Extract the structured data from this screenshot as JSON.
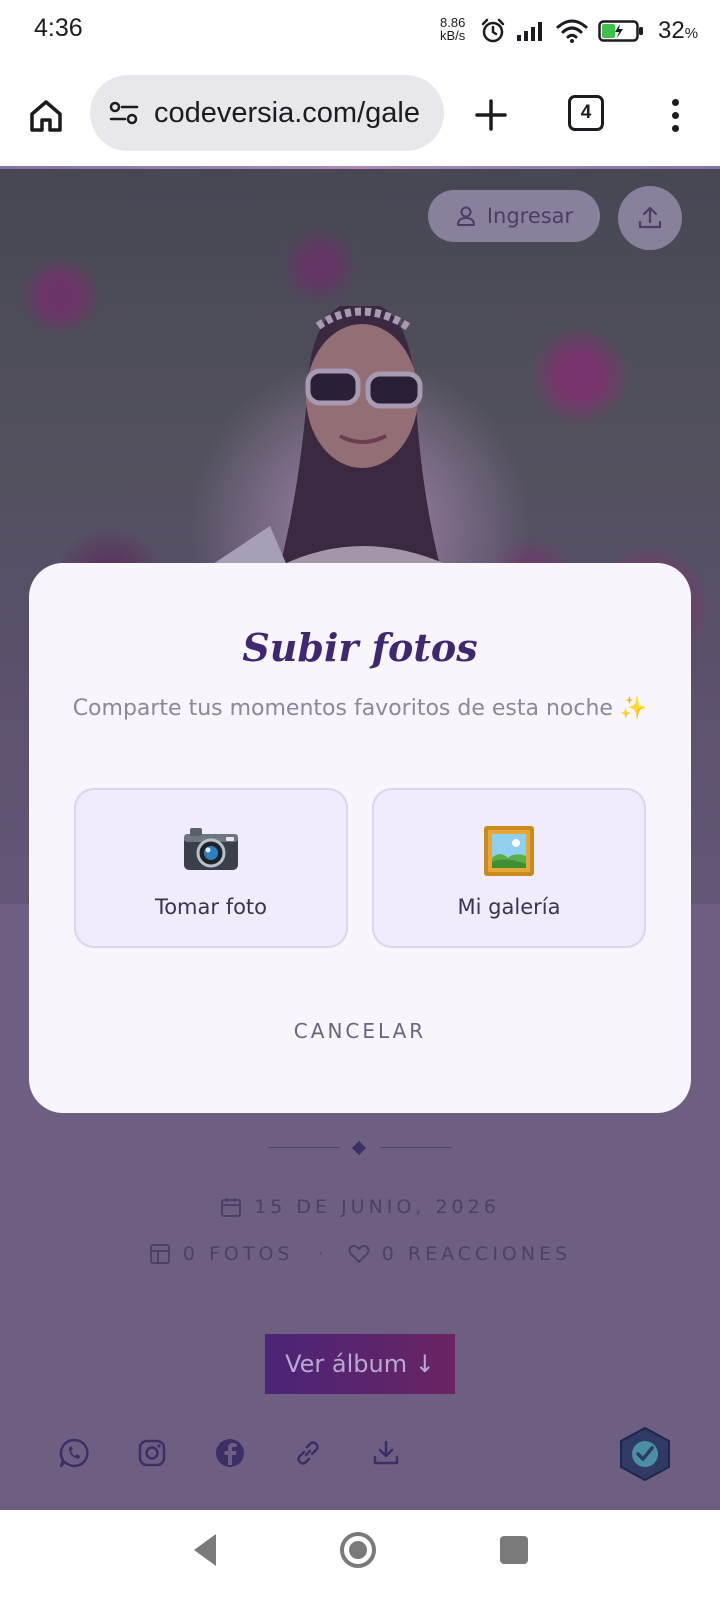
{
  "status_bar": {
    "time": "4:36",
    "speed_value": "8.86",
    "speed_unit": "kB/s",
    "battery_percent": "32",
    "battery_unit": "%",
    "icons": [
      "alarm-icon",
      "signal-icon",
      "wifi-icon",
      "battery-charging-icon"
    ]
  },
  "browser": {
    "url": "codeversia.com/gale",
    "tab_count": "4",
    "icons": [
      "home-icon",
      "site-settings-icon",
      "new-tab-plus-icon",
      "tabs-icon",
      "more-menu-icon"
    ]
  },
  "page": {
    "login_label": "Ingresar",
    "date": "15 DE JUNIO, 2026",
    "photos": "0 FOTOS",
    "separator": "·",
    "reactions": "0 REACCIONES",
    "album_button": "Ver álbum ↓",
    "social_icons": [
      "whatsapp-icon",
      "instagram-icon",
      "facebook-icon",
      "link-icon",
      "download-icon"
    ]
  },
  "modal": {
    "title": "Subir fotos",
    "subtitle": "Comparte tus momentos favoritos de esta noche ✨",
    "options": [
      {
        "icon": "📷",
        "label": "Tomar foto"
      },
      {
        "icon": "🖼️",
        "label": "Mi galería"
      }
    ],
    "cancel_label": "CANCELAR"
  },
  "colors": {
    "modal_title": "#3f2870",
    "page_overlay": "#6e5f82",
    "album_button_start": "#4b2478",
    "album_button_end": "#6a2463"
  }
}
